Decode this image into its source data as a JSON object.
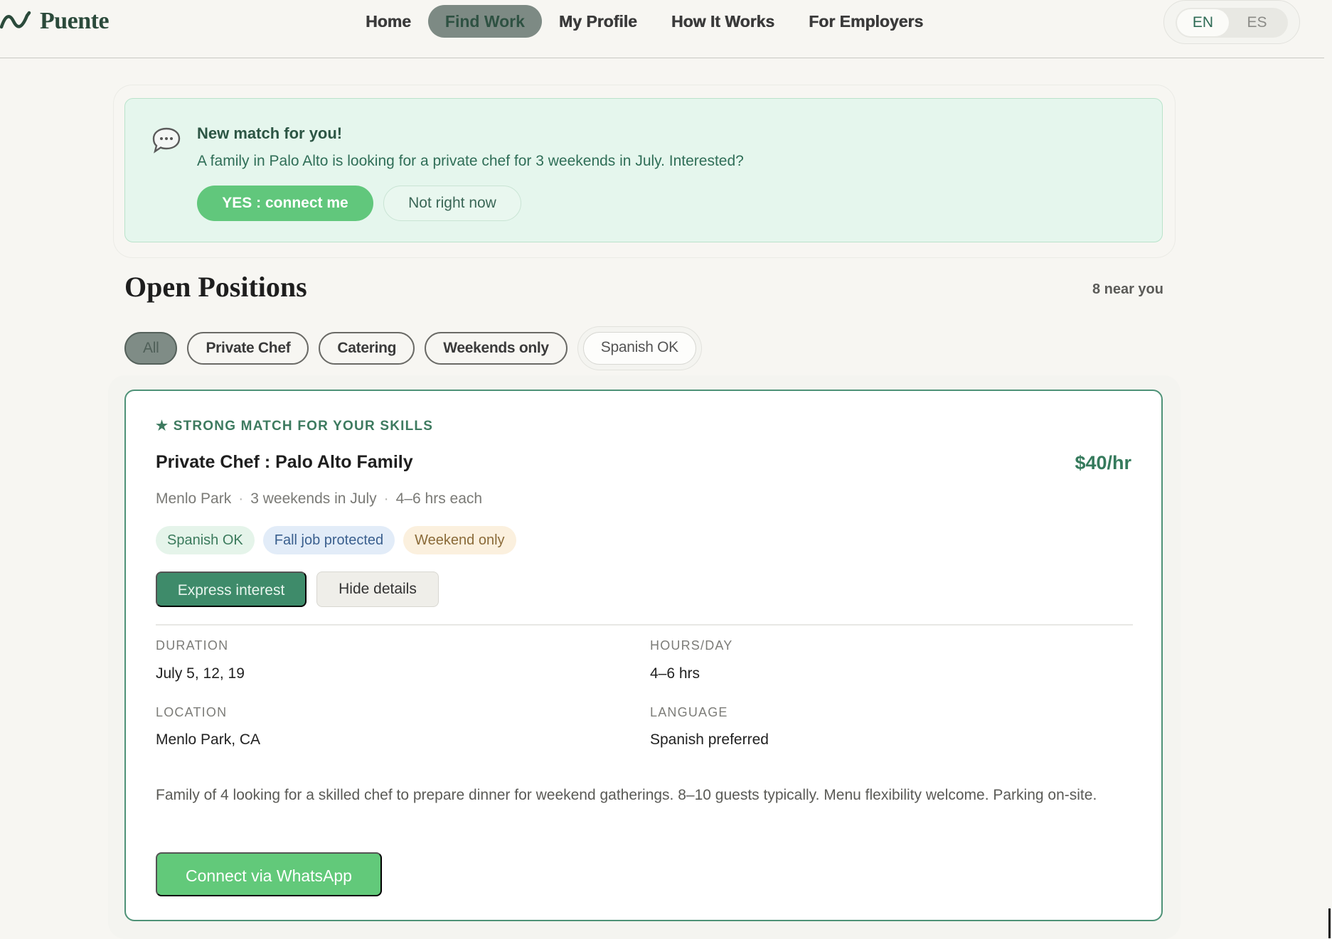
{
  "brand": {
    "name": "Puente",
    "logo_icon": "wave-icon",
    "color": "#2b4a3b"
  },
  "nav": {
    "items": [
      {
        "label": "Home",
        "active": false
      },
      {
        "label": "Find Work",
        "active": true
      },
      {
        "label": "My Profile",
        "active": false
      },
      {
        "label": "How It Works",
        "active": false
      },
      {
        "label": "For Employers",
        "active": false
      }
    ]
  },
  "language": {
    "options": [
      "EN",
      "ES"
    ],
    "selected": "EN"
  },
  "alert": {
    "icon": "chat-bubble-icon",
    "title": "New match for you!",
    "text": "A family in Palo Alto is looking for a private chef for 3 weekends in July. Interested?",
    "accept_label": "YES : connect me",
    "decline_label": "Not right now"
  },
  "positions": {
    "title": "Open Positions",
    "count_label": "8 near you",
    "filters": [
      {
        "label": "All",
        "active": true
      },
      {
        "label": "Private Chef",
        "active": false
      },
      {
        "label": "Catering",
        "active": false
      },
      {
        "label": "Weekends only",
        "active": false
      },
      {
        "label": "Spanish OK",
        "active": false
      }
    ]
  },
  "job": {
    "match_label": "★ STRONG MATCH FOR YOUR SKILLS",
    "title": "Private Chef : Palo Alto Family",
    "pay": "$40/hr",
    "meta": [
      "Menlo Park",
      "3 weekends in July",
      "4–6 hrs each"
    ],
    "tags": [
      {
        "label": "Spanish OK",
        "tone": "green"
      },
      {
        "label": "Fall job protected",
        "tone": "blue"
      },
      {
        "label": "Weekend only",
        "tone": "amber"
      }
    ],
    "express_label": "Express interest",
    "hide_label": "Hide details",
    "details": {
      "duration_label": "DURATION",
      "duration_value": "July 5, 12, 19",
      "hours_label": "HOURS/DAY",
      "hours_value": "4–6 hrs",
      "location_label": "LOCATION",
      "location_value": "Menlo Park, CA",
      "language_label": "LANGUAGE",
      "language_value": "Spanish preferred"
    },
    "description": "Family of 4 looking for a skilled chef to prepare dinner for weekend gatherings. 8–10 guests typically. Menu flexibility welcome. Parking on-site.",
    "whatsapp_label": "Connect via WhatsApp"
  },
  "colors": {
    "accent": "#3e8b6a",
    "accent_light": "#61c77c",
    "alert_bg": "#e5f6ed",
    "background": "#f7f6f2"
  }
}
